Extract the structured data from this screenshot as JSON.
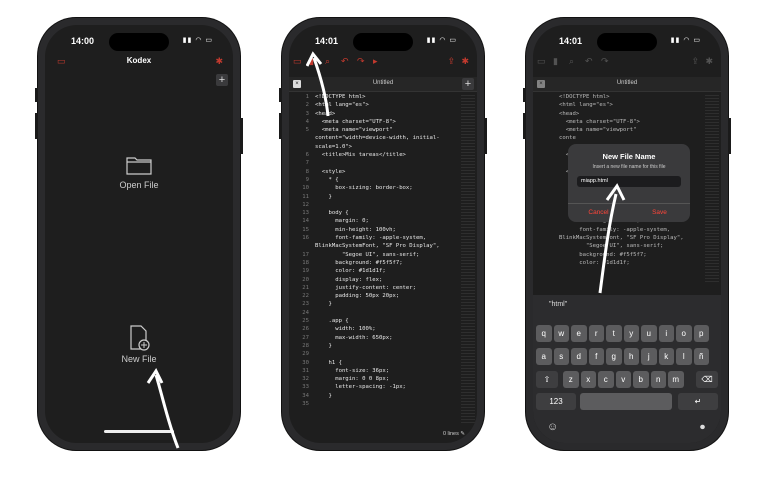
{
  "phone1": {
    "time": "14:00",
    "title": "Kodex",
    "open_label": "Open File",
    "new_label": "New File"
  },
  "phone2": {
    "time": "14:01",
    "tab_title": "Untitled",
    "status": "0 lines",
    "lines": [
      {
        "n": "1",
        "t": "<!DOCTYPE html>"
      },
      {
        "n": "2",
        "t": "<html lang=\"es\">"
      },
      {
        "n": "3",
        "t": "<head>"
      },
      {
        "n": "4",
        "t": "  <meta charset=\"UTF-8\">"
      },
      {
        "n": "5",
        "t": "  <meta name=\"viewport\""
      },
      {
        "n": "",
        "t": "content=\"width=device-width, initial-"
      },
      {
        "n": "",
        "t": "scale=1.0\">"
      },
      {
        "n": "6",
        "t": "  <title>Mis tareas</title>"
      },
      {
        "n": "7",
        "t": ""
      },
      {
        "n": "8",
        "t": "  <style>"
      },
      {
        "n": "9",
        "t": "    * {"
      },
      {
        "n": "10",
        "t": "      box-sizing: border-box;"
      },
      {
        "n": "11",
        "t": "    }"
      },
      {
        "n": "12",
        "t": ""
      },
      {
        "n": "13",
        "t": "    body {"
      },
      {
        "n": "14",
        "t": "      margin: 0;"
      },
      {
        "n": "15",
        "t": "      min-height: 100vh;"
      },
      {
        "n": "16",
        "t": "      font-family: -apple-system,"
      },
      {
        "n": "",
        "t": "BlinkMacSystemFont, \"SF Pro Display\","
      },
      {
        "n": "17",
        "t": "        \"Segoe UI\", sans-serif;"
      },
      {
        "n": "18",
        "t": "      background: #f5f5f7;"
      },
      {
        "n": "19",
        "t": "      color: #1d1d1f;"
      },
      {
        "n": "20",
        "t": "      display: flex;"
      },
      {
        "n": "21",
        "t": "      justify-content: center;"
      },
      {
        "n": "22",
        "t": "      padding: 50px 20px;"
      },
      {
        "n": "23",
        "t": "    }"
      },
      {
        "n": "24",
        "t": ""
      },
      {
        "n": "25",
        "t": "    .app {"
      },
      {
        "n": "26",
        "t": "      width: 100%;"
      },
      {
        "n": "27",
        "t": "      max-width: 650px;"
      },
      {
        "n": "28",
        "t": "    }"
      },
      {
        "n": "29",
        "t": ""
      },
      {
        "n": "30",
        "t": "    h1 {"
      },
      {
        "n": "31",
        "t": "      font-size: 36px;"
      },
      {
        "n": "32",
        "t": "      margin: 0 0 8px;"
      },
      {
        "n": "33",
        "t": "      letter-spacing: -1px;"
      },
      {
        "n": "34",
        "t": "    }"
      },
      {
        "n": "35",
        "t": ""
      }
    ]
  },
  "phone3": {
    "time": "14:01",
    "tab_title": "Untitled",
    "lines": [
      {
        "n": "",
        "t": "<!DOCTYPE html>"
      },
      {
        "n": "",
        "t": "<html lang=\"es\">"
      },
      {
        "n": "",
        "t": "<head>"
      },
      {
        "n": "",
        "t": "  <meta charset=\"UTF-8\">"
      },
      {
        "n": "",
        "t": "  <meta name=\"viewport\""
      },
      {
        "n": "",
        "t": "conte"
      },
      {
        "n": "",
        "t": ""
      },
      {
        "n": "",
        "t": "  <t"
      },
      {
        "n": "",
        "t": ""
      },
      {
        "n": "",
        "t": "  <s"
      },
      {
        "n": "",
        "t": ""
      },
      {
        "n": "",
        "t": ""
      },
      {
        "n": "",
        "t": ""
      },
      {
        "n": "",
        "t": "    body {"
      },
      {
        "n": "",
        "t": "      margin: 0;"
      },
      {
        "n": "",
        "t": "      min-height: 100vh;"
      },
      {
        "n": "",
        "t": "      font-family: -apple-system,"
      },
      {
        "n": "",
        "t": "BlinkMacSystemFont, \"SF Pro Display\","
      },
      {
        "n": "",
        "t": "        \"Segoe UI\", sans-serif;"
      },
      {
        "n": "",
        "t": "      background: #f5f5f7;"
      },
      {
        "n": "",
        "t": "      color: #1d1d1f;"
      }
    ],
    "dialog": {
      "title": "New File Name",
      "subtitle": "Insert a new file name for this file",
      "value": "miapp.html",
      "cancel": "Cancel",
      "save": "Save"
    },
    "suggestion": "\"html\"",
    "keys_row1": [
      "q",
      "w",
      "e",
      "r",
      "t",
      "y",
      "u",
      "i",
      "o",
      "p"
    ],
    "keys_row2": [
      "a",
      "s",
      "d",
      "f",
      "g",
      "h",
      "j",
      "k",
      "l",
      "ñ"
    ],
    "keys_row3": [
      "z",
      "x",
      "c",
      "v",
      "b",
      "n",
      "m"
    ],
    "key_123": "123"
  },
  "colors": {
    "accent": "#c33a2e",
    "background": "#1e1e1e"
  }
}
